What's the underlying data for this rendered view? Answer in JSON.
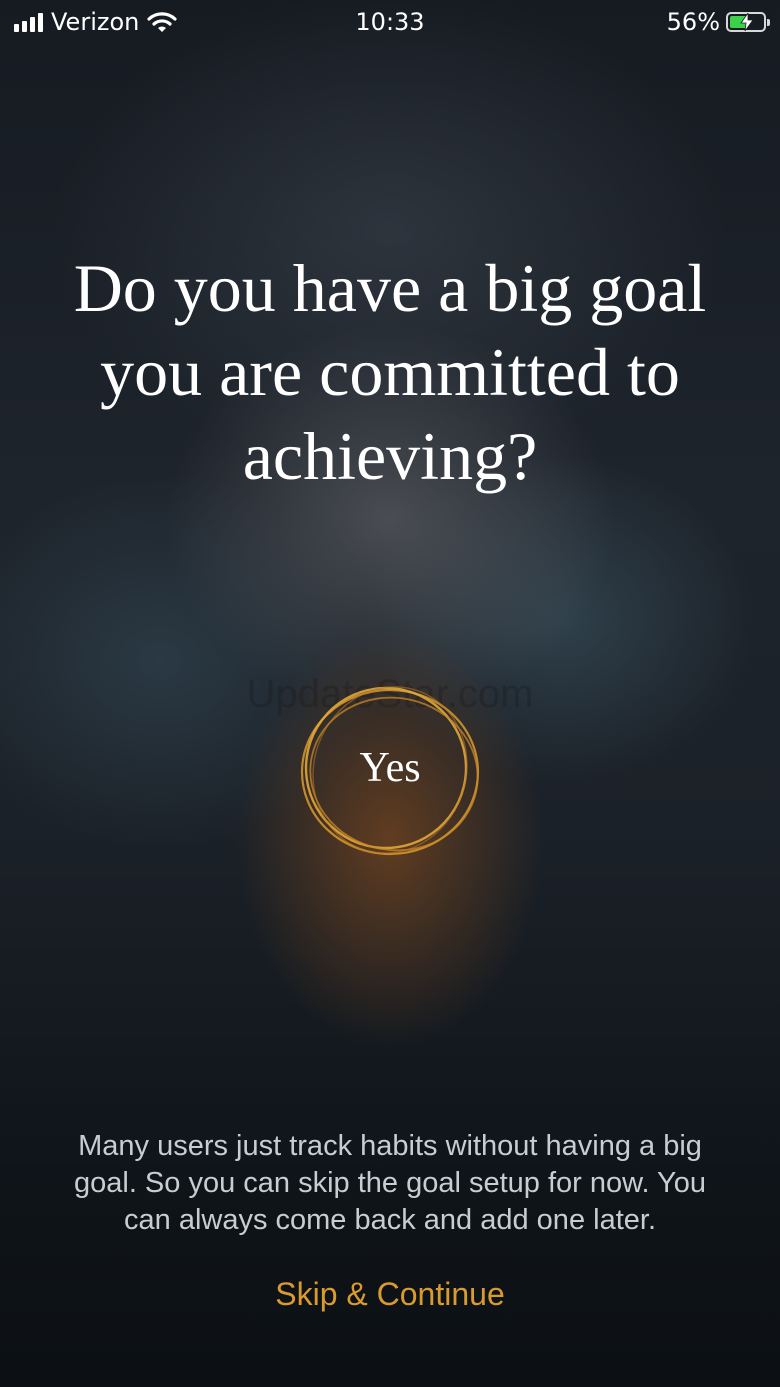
{
  "status_bar": {
    "carrier": "Verizon",
    "time": "10:33",
    "battery_percent": "56%",
    "battery_level": 0.56,
    "signal_icon": "signal-bars-icon",
    "wifi_icon": "wifi-icon",
    "battery_icon": "battery-charging-icon"
  },
  "question": {
    "line1": "Do you have a big goal",
    "line2": "you are committed to",
    "line3": "achieving?"
  },
  "watermark": "UpdateStar.com",
  "yes_button": {
    "label": "Yes",
    "ring_color": "#d99a2e"
  },
  "info": {
    "line1": "Many users just track habits without having a big",
    "line2": "goal. So you can skip the goal setup for now. You",
    "line3": "can always come back and add one later."
  },
  "skip_button": {
    "label": "Skip & Continue",
    "color": "#d99a2e"
  }
}
